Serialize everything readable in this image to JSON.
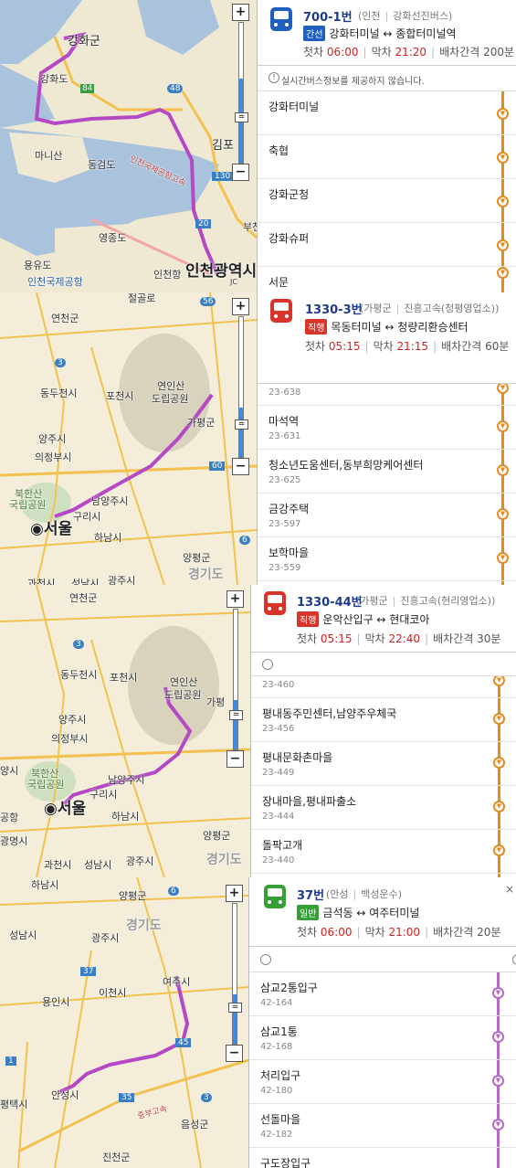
{
  "colors": {
    "route_line": "#b549c5",
    "blue_bus": "#1f5fbf",
    "red_bus": "#d8342a",
    "green_bus": "#36a036",
    "orange_line": "#e38b21",
    "purple_line": "#b56ac6"
  },
  "panels": [
    {
      "map_labels": [
        "강화군",
        "강화도",
        "84",
        "48",
        "마니산",
        "동검도",
        "김포",
        "인천국제공항고속",
        "130",
        "영종도",
        "20",
        "용유도",
        "인천국제공항",
        "인천항",
        "인천광역시",
        "부천",
        "JC"
      ],
      "bus": {
        "icon": "bus-icon-blue",
        "number": "700-1번",
        "region": "인천",
        "company": "강화선진버스",
        "type_tag": "간선",
        "route": "강화터미널 ↔ 종합터미널역",
        "first_label": "첫차",
        "first": "06:00",
        "last_label": "막차",
        "last": "21:20",
        "interval_label": "배차간격",
        "interval": "200분"
      },
      "notice": "실시간버스정보를 제공하지 않습니다.",
      "stops": [
        {
          "name": "강화터미널",
          "id": ""
        },
        {
          "name": "축협",
          "id": ""
        },
        {
          "name": "강화군청",
          "id": ""
        },
        {
          "name": "강화슈퍼",
          "id": ""
        },
        {
          "name": "서문",
          "id": ""
        }
      ]
    },
    {
      "map_labels": [
        "절골로",
        "56",
        "연천군",
        "3",
        "동두천시",
        "포천시",
        "연인산",
        "도립공원",
        "가평군",
        "양주시",
        "의정부시",
        "60",
        "북한산",
        "국립공원",
        "남양주시",
        "구리시",
        "서울",
        "하남시",
        "양평군",
        "경기도",
        "광주시",
        "과천시",
        "성남시",
        "6"
      ],
      "bus": {
        "icon": "bus-icon-red",
        "number": "1330-3번",
        "region": "가평군",
        "company": "진흥고속(청평영업소)",
        "type_tag": "직행",
        "route": "목동터미널 ↔ 청량리환승센터",
        "first_label": "첫차",
        "first": "05:15",
        "last_label": "막차",
        "last": "21:15",
        "interval_label": "배차간격",
        "interval": "60분"
      },
      "stops": [
        {
          "name": "",
          "id": "23-638"
        },
        {
          "name": "마석역",
          "id": "23-631"
        },
        {
          "name": "청소년도움센터,동부희망케어센터",
          "id": "23-625"
        },
        {
          "name": "금강주택",
          "id": "23-597"
        },
        {
          "name": "보학마을",
          "id": "23-559"
        }
      ]
    },
    {
      "map_labels": [
        "연천군",
        "3",
        "동두천시",
        "포천시",
        "연인산",
        "도립공원",
        "가평",
        "양주시",
        "의정부시",
        "양시",
        "북한산",
        "국립공원",
        "남양주시",
        "구리시",
        "서울",
        "공항",
        "하남시",
        "광명시",
        "양평군",
        "과천시",
        "성남시",
        "광주시",
        "경기도"
      ],
      "bus": {
        "icon": "bus-icon-red",
        "number": "1330-44번",
        "region": "가평군",
        "company": "진흥고속(현리영업소)",
        "type_tag": "직행",
        "route": "운악산입구 ↔ 현대코아",
        "first_label": "첫차",
        "first": "05:15",
        "last_label": "막차",
        "last": "22:40",
        "interval_label": "배차간격",
        "interval": "30분"
      },
      "stops": [
        {
          "name": "",
          "id": "23-460"
        },
        {
          "name": "평내동주민센터,남양주우체국",
          "id": "23-456"
        },
        {
          "name": "평내문화촌마을",
          "id": "23-449"
        },
        {
          "name": "장내마을,평내파출소",
          "id": "23-444"
        },
        {
          "name": "돌팍고개",
          "id": "23-440"
        }
      ]
    },
    {
      "map_labels": [
        "하남시",
        "양평군",
        "6",
        "성남시",
        "경기도",
        "광주시",
        "37",
        "이천시",
        "여주시",
        "용인시",
        "1",
        "45",
        "35",
        "3",
        "안성시",
        "평택시",
        "음성군",
        "진천군",
        "중부고속"
      ],
      "bus": {
        "icon": "bus-icon-green",
        "number": "37번",
        "region": "안성",
        "company": "백성운수",
        "type_tag": "일반",
        "route": "금석동 ↔ 여주터미널",
        "first_label": "첫차",
        "first": "06:00",
        "last_label": "막차",
        "last": "21:00",
        "interval_label": "배차간격",
        "interval": "20분"
      },
      "stops": [
        {
          "name": "삼교2통입구",
          "id": "42-164"
        },
        {
          "name": "삼교1통",
          "id": "42-168"
        },
        {
          "name": "처리입구",
          "id": "42-180"
        },
        {
          "name": "선돌마을",
          "id": "42-182"
        },
        {
          "name": "구도장입구",
          "id": ""
        }
      ]
    }
  ]
}
